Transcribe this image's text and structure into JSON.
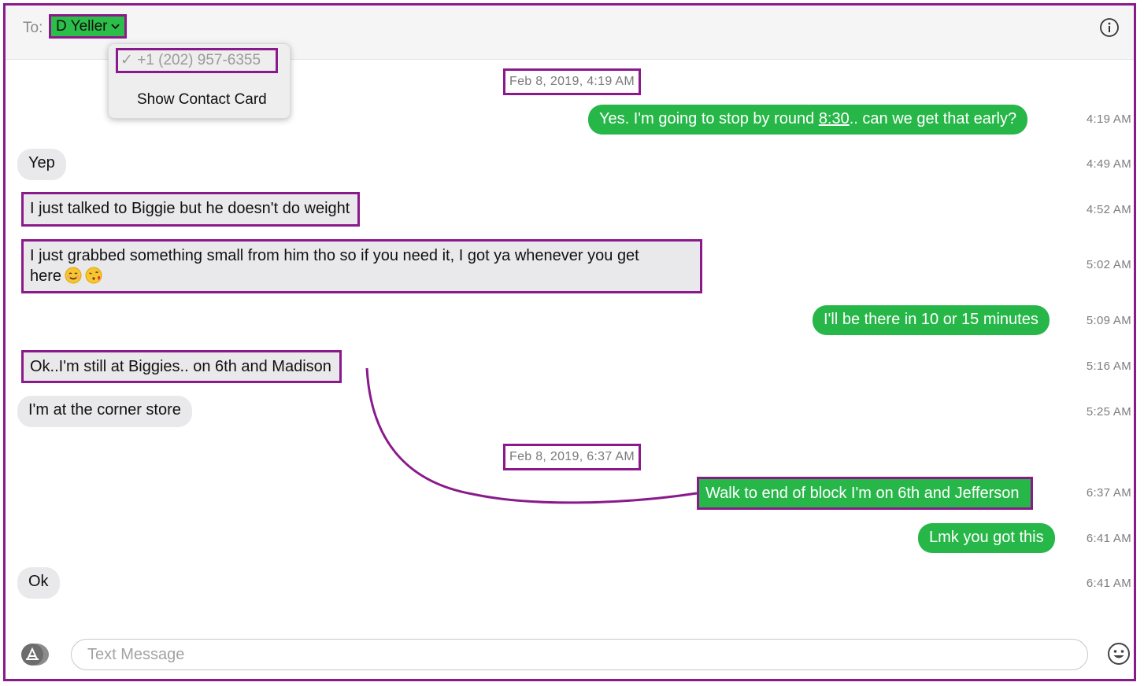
{
  "header": {
    "to_label": "To:",
    "recipient": "D Yeller"
  },
  "dropdown": {
    "phone": "✓ +1 (202) 957-6355",
    "contact_card": "Show Contact Card"
  },
  "date_stamps": [
    "Feb 8, 2019, 4:19 AM",
    "Feb 8, 2019, 6:37 AM"
  ],
  "messages": [
    {
      "text": "Yes. I'm going to stop by round ",
      "link": "8:30",
      "text_after": ".. can we get that early?",
      "time": "4:19 AM",
      "sender": "me"
    },
    {
      "text": "Yep",
      "time": "4:49 AM",
      "sender": "them"
    },
    {
      "text": "I just talked to Biggie but he doesn't do weight",
      "time": "4:52 AM",
      "sender": "them"
    },
    {
      "text": "I just grabbed something small from him tho so if you need it, I got ya whenever you get",
      "text_line2": "here",
      "time": "5:02 AM",
      "sender": "them"
    },
    {
      "text": "I'll be there in 10 or 15 minutes",
      "time": "5:09 AM",
      "sender": "me"
    },
    {
      "text": "Ok..I'm still at Biggies.. on 6th and Madison",
      "time": "5:16 AM",
      "sender": "them"
    },
    {
      "text": "I'm at the corner store",
      "time": "5:25 AM",
      "sender": "them"
    },
    {
      "text": "Walk to end of block I'm on 6th and Jefferson",
      "time": "6:37 AM",
      "sender": "me"
    },
    {
      "text": "Lmk you got this",
      "time": "6:41 AM",
      "sender": "me"
    },
    {
      "text": "Ok",
      "time": "6:41 AM",
      "sender": "them"
    }
  ],
  "composer": {
    "placeholder": "Text Message"
  },
  "colors": {
    "sent_bubble": "#27b748",
    "received_bubble": "#e9e9eb",
    "annotation": "#8a1a8c"
  },
  "icons": [
    "info-icon",
    "chevron-down-icon",
    "app-store-icon",
    "emoji-icon"
  ]
}
